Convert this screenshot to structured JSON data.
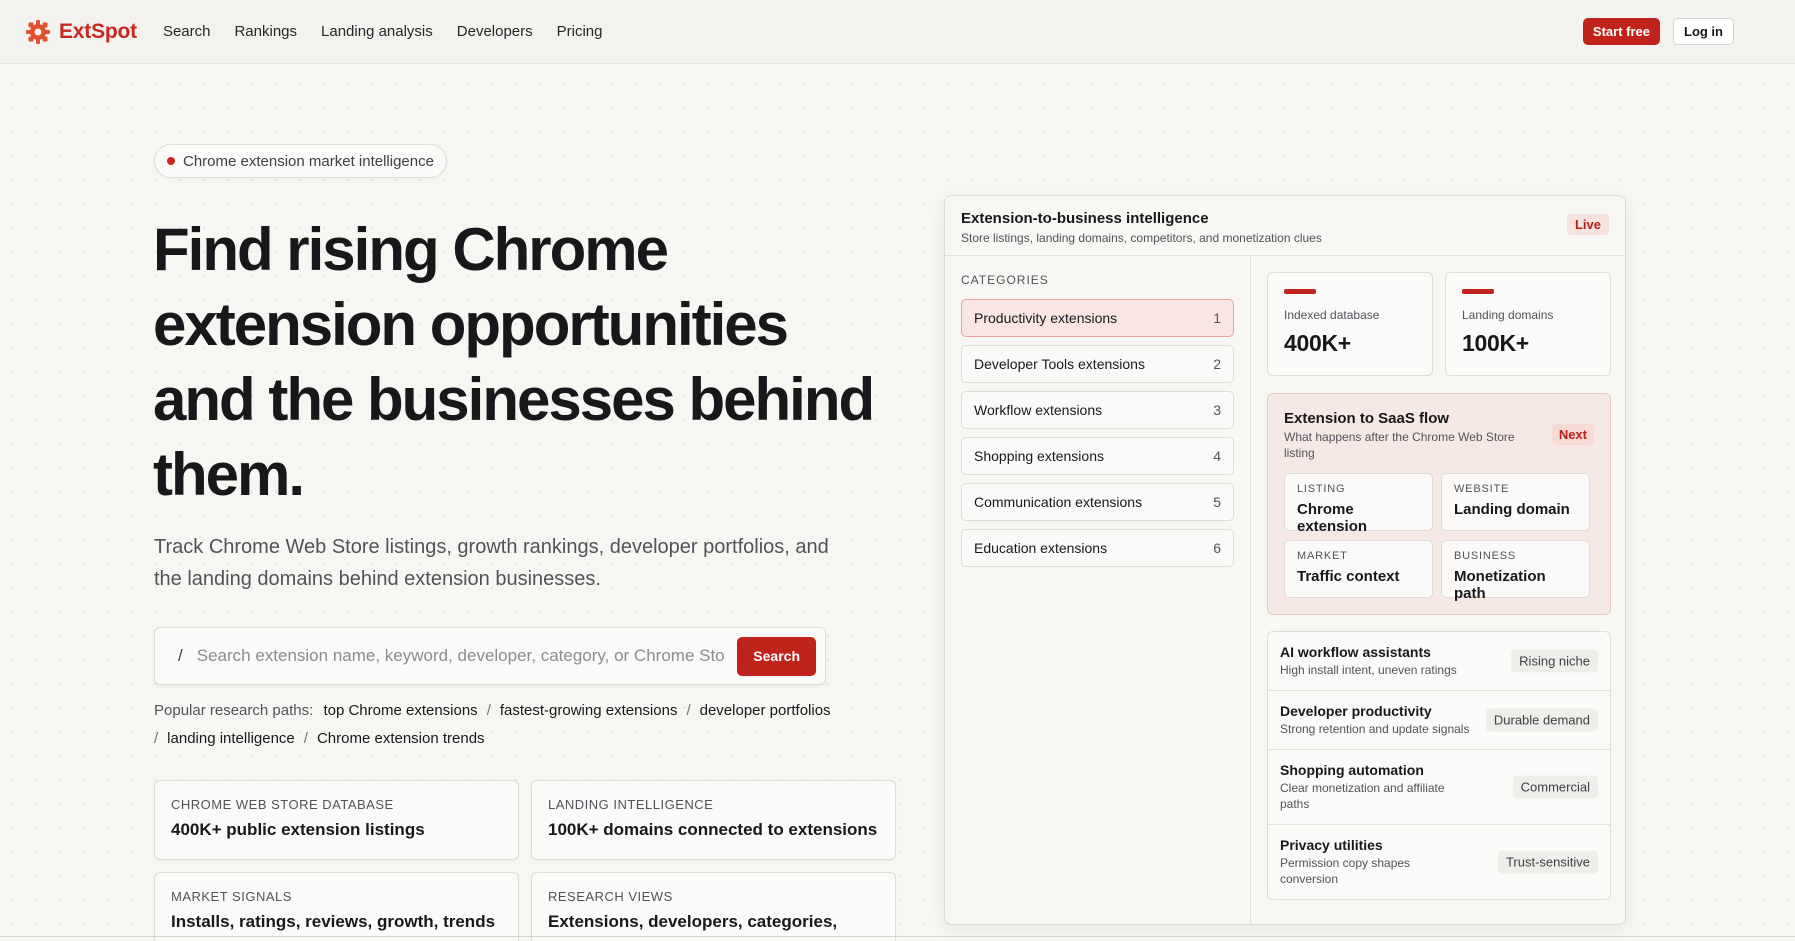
{
  "header": {
    "brand": "ExtSpot",
    "nav": [
      "Search",
      "Rankings",
      "Landing analysis",
      "Developers",
      "Pricing"
    ],
    "start_free": "Start free",
    "log_in": "Log in"
  },
  "hero": {
    "pill": "Chrome extension market intelligence",
    "title": "Find rising Chrome extension opportunities and the businesses behind them.",
    "subtitle": "Track Chrome Web Store listings, growth rankings, developer portfolios, and the landing domains behind extension businesses.",
    "search": {
      "slash": "/",
      "placeholder": "Search extension name, keyword, developer, category, or Chrome Store URL",
      "button": "Search"
    },
    "popular": {
      "label": "Popular research paths:",
      "links": [
        "top Chrome extensions",
        "fastest-growing extensions",
        "developer portfolios",
        "landing intelligence",
        "Chrome extension trends"
      ]
    },
    "stats": [
      {
        "key": "CHROME WEB STORE DATABASE",
        "value": "400K+ public extension listings"
      },
      {
        "key": "LANDING INTELLIGENCE",
        "value": "100K+ domains connected to extensions"
      },
      {
        "key": "MARKET SIGNALS",
        "value": "Installs, ratings, reviews, growth, trends"
      },
      {
        "key": "RESEARCH VIEWS",
        "value": "Extensions, developers, categories,"
      }
    ]
  },
  "panel": {
    "title": "Extension-to-business intelligence",
    "subtitle": "Store listings, landing domains, competitors, and monetization clues",
    "live": "Live",
    "categories_label": "CATEGORIES",
    "categories": [
      {
        "name": "Productivity extensions",
        "n": "1"
      },
      {
        "name": "Developer Tools extensions",
        "n": "2"
      },
      {
        "name": "Workflow extensions",
        "n": "3"
      },
      {
        "name": "Shopping extensions",
        "n": "4"
      },
      {
        "name": "Communication extensions",
        "n": "5"
      },
      {
        "name": "Education extensions",
        "n": "6"
      }
    ],
    "metrics": [
      {
        "key": "Indexed database",
        "value": "400K+"
      },
      {
        "key": "Landing domains",
        "value": "100K+"
      }
    ],
    "flow": {
      "title": "Extension to SaaS flow",
      "subtitle": "What happens after the Chrome Web Store listing",
      "badge": "Next",
      "cells": [
        {
          "key": "LISTING",
          "value": "Chrome extension"
        },
        {
          "key": "WEBSITE",
          "value": "Landing domain"
        },
        {
          "key": "MARKET",
          "value": "Traffic context"
        },
        {
          "key": "BUSINESS",
          "value": "Monetization path"
        }
      ]
    },
    "niches": [
      {
        "title": "AI workflow assistants",
        "desc": "High install intent, uneven ratings",
        "tag": "Rising niche"
      },
      {
        "title": "Developer productivity",
        "desc": "Strong retention and update signals",
        "tag": "Durable demand"
      },
      {
        "title": "Shopping automation",
        "desc": "Clear monetization and affiliate paths",
        "tag": "Commercial"
      },
      {
        "title": "Privacy utilities",
        "desc": "Permission copy shapes conversion",
        "tag": "Trust-sensitive"
      }
    ]
  },
  "colors": {
    "accent": "#c0221c",
    "background": "#f7f6f3"
  }
}
